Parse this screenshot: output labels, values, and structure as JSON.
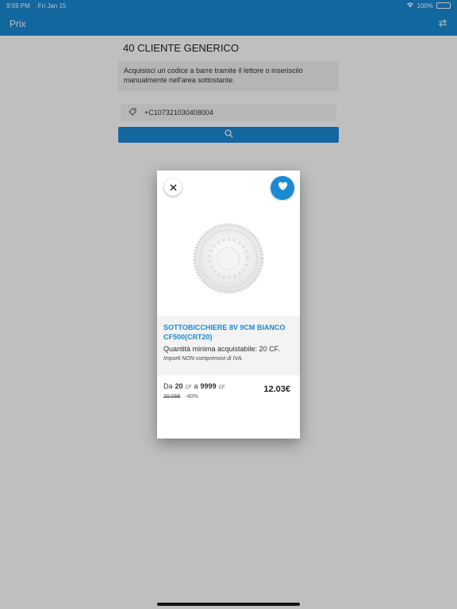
{
  "status": {
    "time": "9:59 PM",
    "date": "Fri Jan 15",
    "battery": "100%"
  },
  "nav": {
    "title": "Prix",
    "swap_icon": "swap-icon"
  },
  "page": {
    "customer": "40 CLIENTE GENERICO",
    "instruction": "Acquisisci un codice a barre tramite il lettore o inseriscilo manualmente nell'area sottostante.",
    "barcode_value": "+C107321030408004"
  },
  "product": {
    "name": "SOTTOBICCHIERE 8V 9CM BIANCO CF500(CRT20)",
    "min_qty": "Quantità minima acquistabile: 20 CF.",
    "vat_note": "Importi NON comprensivi di IVA.",
    "range_from_label": "Da",
    "range_from": "20",
    "range_unit": "CF",
    "range_to_label": "a",
    "range_to": "9999",
    "old_price": "20.05€",
    "discount": "-40%",
    "price": "12.03€"
  },
  "colors": {
    "accent": "#1a8ad4"
  }
}
